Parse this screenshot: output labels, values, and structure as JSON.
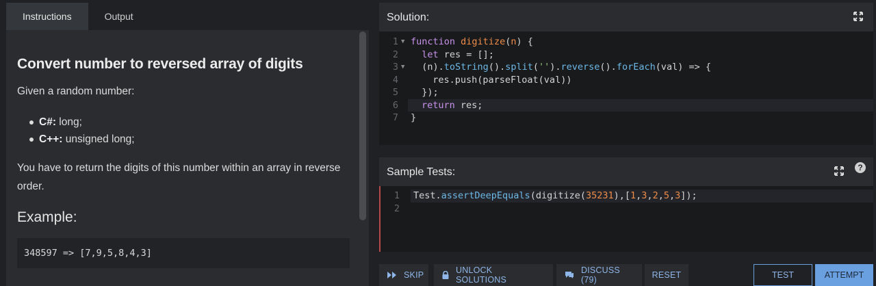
{
  "tabs": [
    {
      "label": "Instructions",
      "active": true
    },
    {
      "label": "Output",
      "active": false
    }
  ],
  "instructions": {
    "title": "Convert number to reversed array of digits",
    "intro": "Given a random number:",
    "bullets": [
      {
        "lang": "C#:",
        "text": " long;"
      },
      {
        "lang": "C++:",
        "text": " unsigned long;"
      }
    ],
    "description": "You have to return the digits of this number within an array in reverse order.",
    "example_heading": "Example:",
    "example_code": "348597 => [7,9,5,8,4,3]"
  },
  "solution": {
    "title": "Solution:",
    "lines": [
      {
        "n": "1",
        "fold": true
      },
      {
        "n": "2",
        "fold": false
      },
      {
        "n": "3",
        "fold": true
      },
      {
        "n": "4",
        "fold": false
      },
      {
        "n": "5",
        "fold": false
      },
      {
        "n": "6",
        "fold": false
      },
      {
        "n": "7",
        "fold": false
      }
    ],
    "code": {
      "l1": [
        "function",
        " ",
        "digitize",
        "(",
        "n",
        ") {"
      ],
      "l2": [
        "  ",
        "let",
        " res = [];"
      ],
      "l3": [
        "  (n).",
        "toString",
        "().",
        "split",
        "(",
        "''",
        ").",
        "reverse",
        "().",
        "forEach",
        "(val) => {"
      ],
      "l4": [
        "  res.push(parseFloat(val))"
      ],
      "l5": [
        "  });"
      ],
      "l6": [
        "return",
        " res;"
      ],
      "l7": [
        "}"
      ]
    }
  },
  "tests": {
    "title": "Sample Tests:",
    "help": "?",
    "lines": [
      {
        "n": "1"
      },
      {
        "n": "2"
      }
    ],
    "code": [
      "Test.",
      "assertDeepEquals",
      "(digitize(",
      "35231",
      "),[",
      "1",
      ",",
      "3",
      ",",
      "2",
      ",",
      "5",
      ",",
      "3",
      "]);"
    ]
  },
  "buttons": {
    "skip": "SKIP",
    "unlock": "UNLOCK SOLUTIONS",
    "discuss": "DISCUSS (79)",
    "reset": "RESET",
    "test": "TEST",
    "attempt": "ATTEMPT"
  },
  "colors": {
    "accent": "#6aa0e0",
    "error_border": "#b84a4a"
  }
}
